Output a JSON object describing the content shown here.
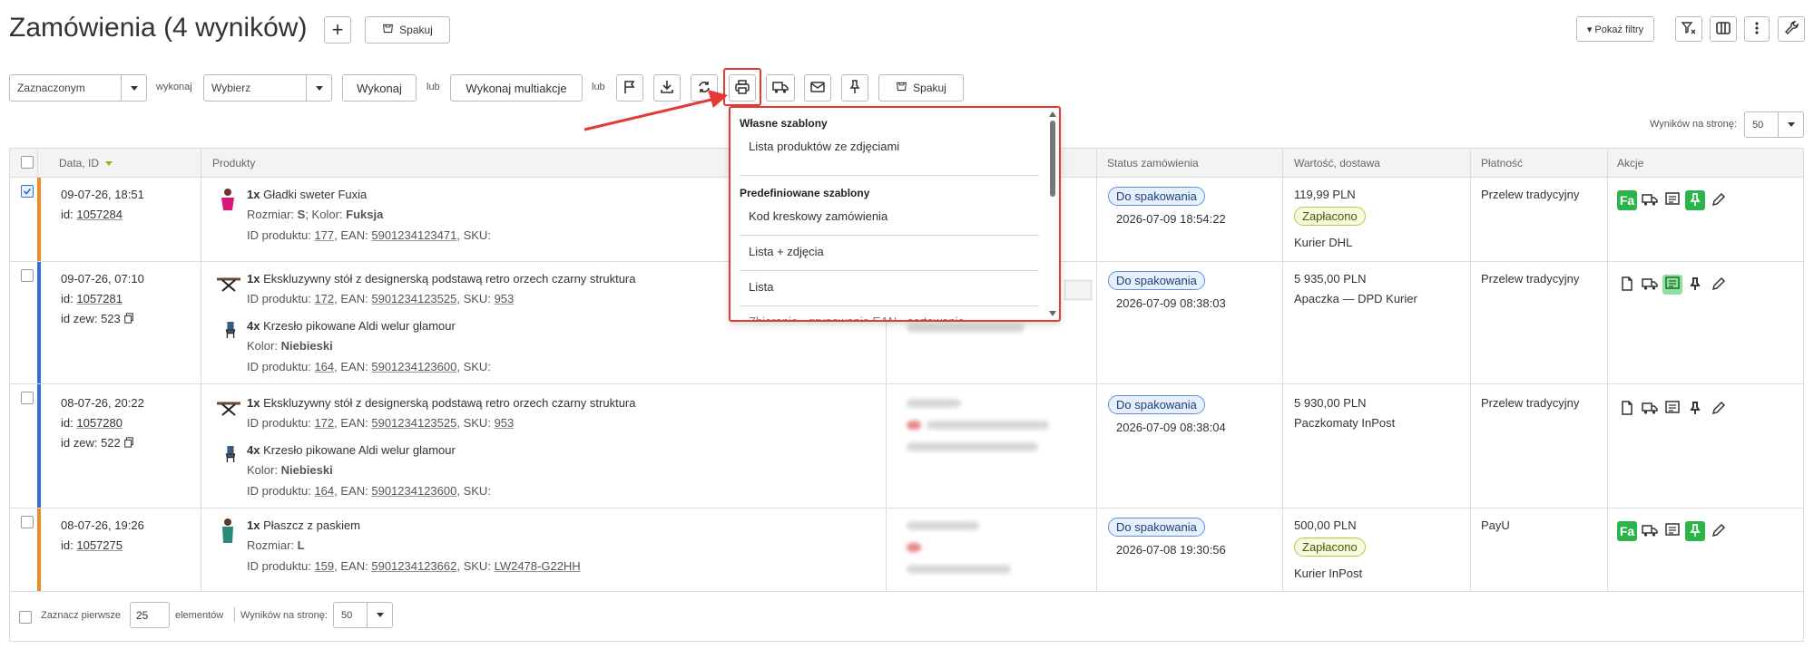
{
  "header": {
    "title": "Zamówienia (4 wyników)",
    "add_label": "+",
    "pack_label": "Spakuj",
    "filters_label": "▾ Pokaż filtry"
  },
  "toolbar": {
    "scope_value": "Zaznaczonym",
    "wykonaj_text": "wykonaj",
    "action_value": "Wybierz",
    "execute_label": "Wykonaj",
    "lub1": "lub",
    "multi_label": "Wykonaj multiakcje",
    "lub2": "lub",
    "pack_label": "Spakuj"
  },
  "per_page": {
    "label": "Wyników na stronę:",
    "value": "50"
  },
  "print_dropdown": {
    "section1": "Własne szablony",
    "section1_items": [
      "Lista produktów ze zdjęciami"
    ],
    "section2": "Predefiniowane szablony",
    "section2_items": [
      "Kod kreskowy zamówienia",
      "Lista + zdjęcia",
      "Lista",
      "Zbieranie - grupowanie EAN - sortowanie"
    ]
  },
  "columns": [
    "Data, ID",
    "Produkty",
    "Status zamówienia",
    "Wartość, dostawa",
    "Płatność",
    "Akcje"
  ],
  "orders": [
    {
      "date": "09-07-26, 18:51",
      "id_label": "id:",
      "id": "1057284",
      "ext_id": "",
      "products": [
        {
          "qty": "1x",
          "name": "Gładki sweter Fuxia",
          "attr_label1": "Rozmiar:",
          "attr_val1": "S",
          "attr_label2": "Kolor:",
          "attr_val2": "Fuksja",
          "pid": "177",
          "ean": "5901234123471",
          "sku": ""
        }
      ],
      "status": "Do spakowania",
      "status_date": "2026-07-09 18:54:22",
      "value": "119,99 PLN",
      "paid": "Zapłacono",
      "delivery": "Kurier DHL",
      "payment": "Przelew tradycyjny"
    },
    {
      "date": "09-07-26, 07:10",
      "id_label": "id:",
      "id": "1057281",
      "ext_id": "id zew: 523",
      "products": [
        {
          "qty": "1x",
          "name": "Ekskluzywny stół z designerską podstawą retro orzech czarny struktura",
          "pid": "172",
          "ean": "5901234123525",
          "sku": "953"
        },
        {
          "qty": "4x",
          "name": "Krzesło pikowane Aldi welur glamour",
          "attr_label1": "Kolor:",
          "attr_val1": "Niebieski",
          "pid": "164",
          "ean": "5901234123600",
          "sku": ""
        }
      ],
      "status": "Do spakowania",
      "status_date": "2026-07-09 08:38:03",
      "value": "5 935,00 PLN",
      "paid": "",
      "delivery": "Apaczka — DPD Kurier",
      "payment": "Przelew tradycyjny"
    },
    {
      "date": "08-07-26, 20:22",
      "id_label": "id:",
      "id": "1057280",
      "ext_id": "id zew: 522",
      "products": [
        {
          "qty": "1x",
          "name": "Ekskluzywny stół z designerską podstawą retro orzech czarny struktura",
          "pid": "172",
          "ean": "5901234123525",
          "sku": "953"
        },
        {
          "qty": "4x",
          "name": "Krzesło pikowane Aldi welur glamour",
          "attr_label1": "Kolor:",
          "attr_val1": "Niebieski",
          "pid": "164",
          "ean": "5901234123600",
          "sku": ""
        }
      ],
      "status": "Do spakowania",
      "status_date": "2026-07-09 08:38:04",
      "value": "5 930,00 PLN",
      "paid": "",
      "delivery": "Paczkomaty InPost",
      "payment": "Przelew tradycyjny"
    },
    {
      "date": "08-07-26, 19:26",
      "id_label": "id:",
      "id": "1057275",
      "ext_id": "",
      "products": [
        {
          "qty": "1x",
          "name": "Płaszcz z paskiem",
          "attr_label1": "Rozmiar:",
          "attr_val1": "L",
          "pid": "159",
          "ean": "5901234123662",
          "sku": "LW2478-G22HH"
        }
      ],
      "status": "Do spakowania",
      "status_date": "2026-07-08 19:30:56",
      "value": "500,00 PLN",
      "paid": "Zapłacono",
      "delivery": "Kurier InPost",
      "payment": "PayU"
    }
  ],
  "labels": {
    "pid": "ID produktu:",
    "ean": "EAN:",
    "sku": "SKU:",
    "fa": "Fa"
  },
  "footer": {
    "select_first": "Zaznacz pierwsze",
    "count": "25",
    "elements": "elementów",
    "per_page_label": "Wyników na stronę:",
    "per_page_value": "50"
  },
  "colors": {
    "stripe_orange": "#f08a24",
    "stripe_blue": "#2f6fd6",
    "highlight_red": "#e53935",
    "action_green": "#2bb44a"
  }
}
